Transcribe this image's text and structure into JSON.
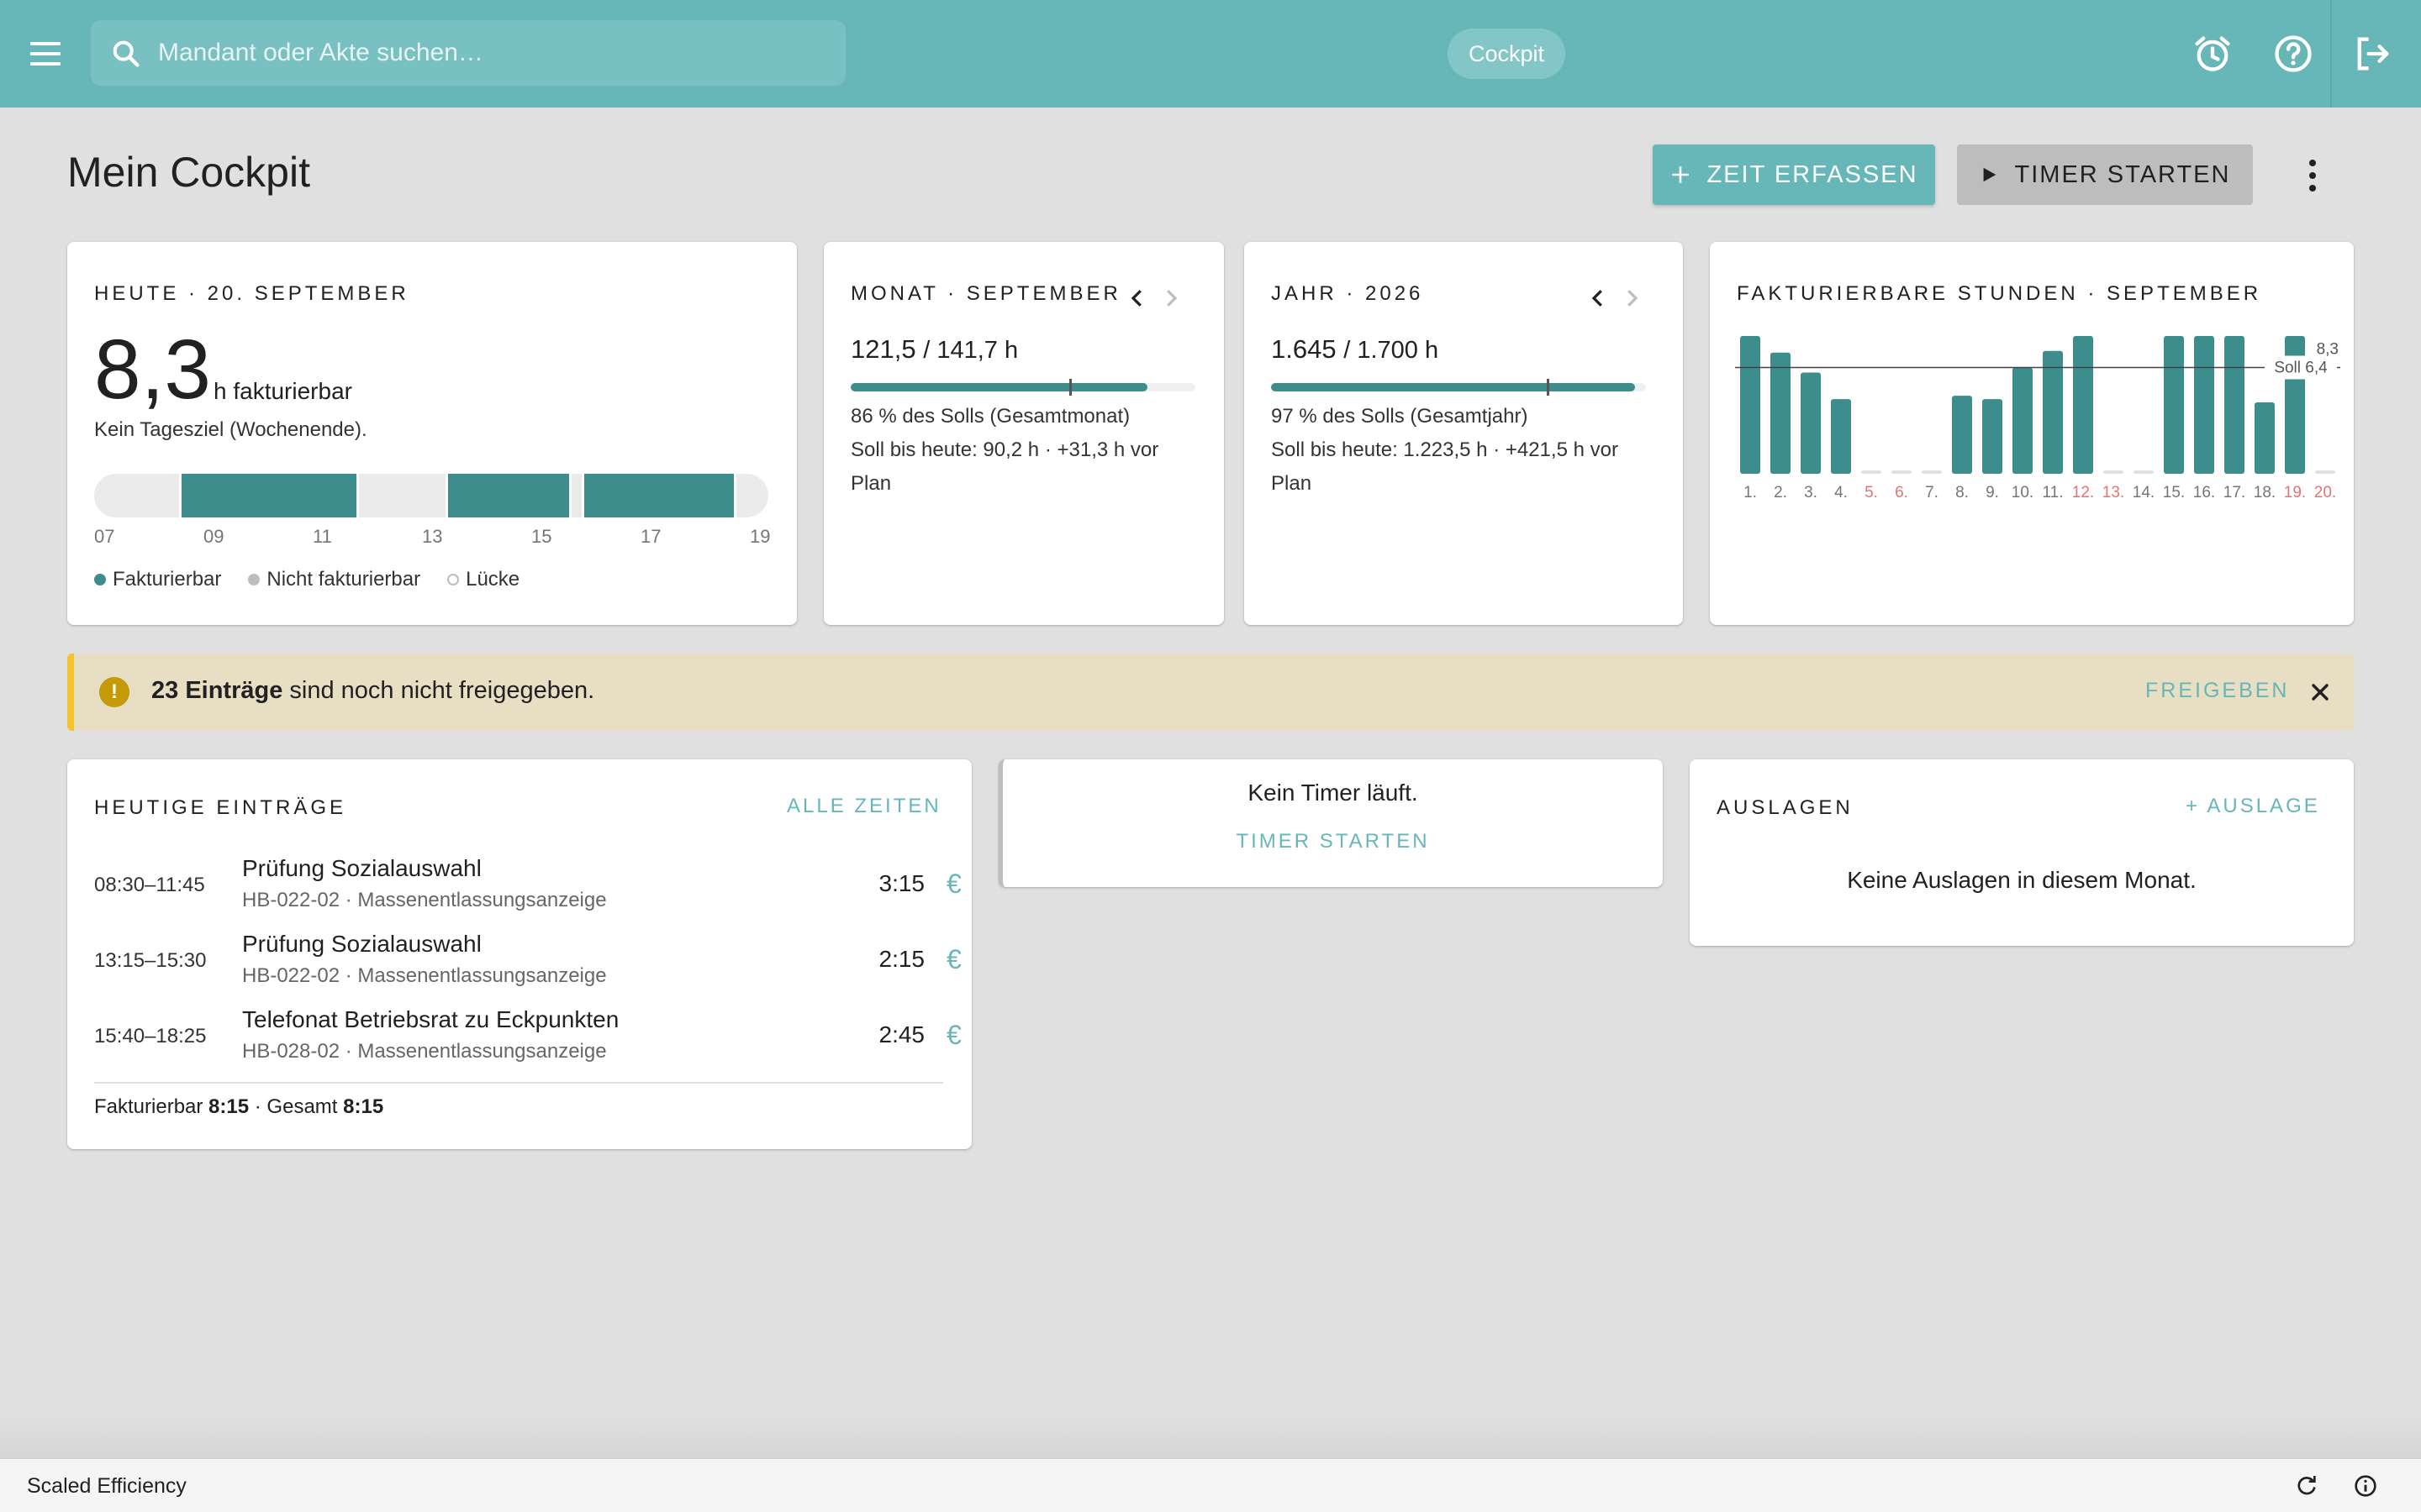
{
  "topbar": {
    "search_placeholder": "Mandant oder Akte suchen…",
    "chip_label": "Cockpit",
    "icons": [
      "menu-icon",
      "search-icon",
      "alarm-icon",
      "help-icon",
      "logout-icon"
    ]
  },
  "header": {
    "title": "Mein Cockpit",
    "add_time_label": "ZEIT ERFASSEN",
    "start_timer_label": "TIMER STARTEN"
  },
  "today": {
    "overline": "HEUTE · 20. SEPTEMBER",
    "hours": "8,3",
    "unit": "h fakturierbar",
    "note": "Kein Tagesziel (Wochenende).",
    "axis_ticks": [
      "07",
      "09",
      "11",
      "13",
      "15",
      "17",
      "19"
    ],
    "legend": [
      "Fakturierbar",
      "Nicht fakturierbar",
      "Lücke"
    ]
  },
  "month": {
    "overline": "MONAT · SEPTEMBER",
    "actual": "121,5",
    "target": "/ 141,7 h",
    "progress_fraction": 0.86,
    "line1": "86 % des Solls (Gesamtmonat)",
    "line2": "Soll bis heute: 90,2 h · +31,3 h vor",
    "line3": "Plan"
  },
  "year": {
    "overline": "JAHR · 2026",
    "actual": "1.645",
    "target": "/ 1.700 h",
    "progress_fraction": 0.97,
    "line1": "97 % des Solls (Gesamtjahr)",
    "line2": "Soll bis heute: 1.223,5 h · +421,5 h vor",
    "line3": "Plan"
  },
  "billable_chart": {
    "overline": "FAKTURIERBARE STUNDEN · SEPTEMBER",
    "soll_label": "Soll 6,4",
    "today_value_label": "8,3"
  },
  "chart_data": {
    "type": "bar",
    "title": "FAKTURIERBARE STUNDEN · SEPTEMBER",
    "categories": [
      "1.",
      "2.",
      "3.",
      "4.",
      "5.",
      "6.",
      "7.",
      "8.",
      "9.",
      "10.",
      "11.",
      "12.",
      "13.",
      "14.",
      "15.",
      "16.",
      "17.",
      "18.",
      "19.",
      "20."
    ],
    "values": [
      8.3,
      7.3,
      6.1,
      4.5,
      0,
      0,
      0,
      4.7,
      4.5,
      6.4,
      7.4,
      8.3,
      0,
      0,
      8.3,
      8.3,
      8.3,
      4.3,
      8.3,
      0,
      8.3
    ],
    "weekend_days": [
      "5.",
      "6.",
      "12.",
      "13.",
      "19.",
      "20."
    ],
    "reference_line": 6.4,
    "ylim": [
      0,
      8.3
    ],
    "colors": {
      "bar": "#3d8d8c",
      "weekend_label": "#e57373",
      "empty": "#e0e0e0"
    }
  },
  "alert": {
    "count_text": "23 Einträge",
    "rest_text": " sind noch nicht freigegeben.",
    "action_label": "FREIGEBEN"
  },
  "entries": {
    "overline": "HEUTIGE EINTRÄGE",
    "all_link": "ALLE ZEITEN",
    "rows": [
      {
        "time": "08:30–11:45",
        "title": "Prüfung Sozialauswahl",
        "sub": "HB-022-02 · Massenentlassungsanzeige",
        "duration": "3:15",
        "billable": "€"
      },
      {
        "time": "13:15–15:30",
        "title": "Prüfung Sozialauswahl",
        "sub": "HB-022-02 · Massenentlassungsanzeige",
        "duration": "2:15",
        "billable": "€"
      },
      {
        "time": "15:40–18:25",
        "title": "Telefonat Betriebsrat zu Eckpunkten",
        "sub": "HB-028-02 · Massenentlassungsanzeige",
        "duration": "2:45",
        "billable": "€"
      }
    ],
    "footer_billable_label": "Fakturierbar",
    "footer_billable_value": "8:15",
    "footer_sep": " · ",
    "footer_total_label": "Gesamt",
    "footer_total_value": "8:15"
  },
  "timer": {
    "status": "Kein Timer läuft.",
    "start_label": "TIMER STARTEN"
  },
  "expenses": {
    "overline": "AUSLAGEN",
    "add_label": "+ AUSLAGE",
    "empty": "Keine Auslagen in diesem Monat."
  },
  "statusbar": {
    "label": "Scaled Efficiency"
  },
  "colors": {
    "brand": "#67b6b8",
    "accent_dark": "#3d8d8c",
    "alert_bg": "#e7dec3",
    "alert_border": "#f4c430"
  }
}
